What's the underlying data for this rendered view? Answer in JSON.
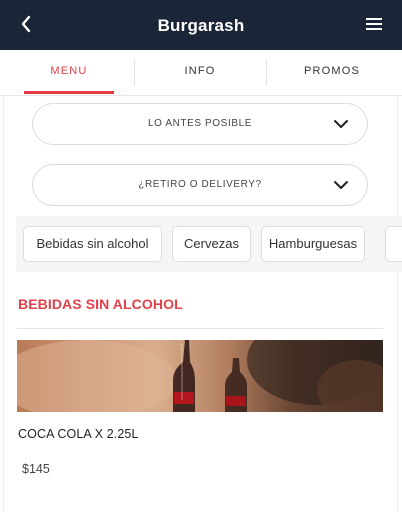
{
  "header": {
    "title": "Burgarash"
  },
  "tabs": [
    {
      "label": "MENU",
      "active": true
    },
    {
      "label": "INFO",
      "active": false
    },
    {
      "label": "PROMOS",
      "active": false
    }
  ],
  "selectors": {
    "time": "LO ANTES POSIBLE",
    "delivery": "¿RETIRO O DELIVERY?"
  },
  "categories": [
    "Bebidas sin alcohol",
    "Cervezas",
    "Hamburguesas"
  ],
  "section": {
    "title": "BEBIDAS SIN ALCOHOL"
  },
  "product": {
    "name": "COCA COLA X 2.25L",
    "price": "$145"
  },
  "colors": {
    "header_bg": "#1a2537",
    "accent": "#e33b45"
  }
}
